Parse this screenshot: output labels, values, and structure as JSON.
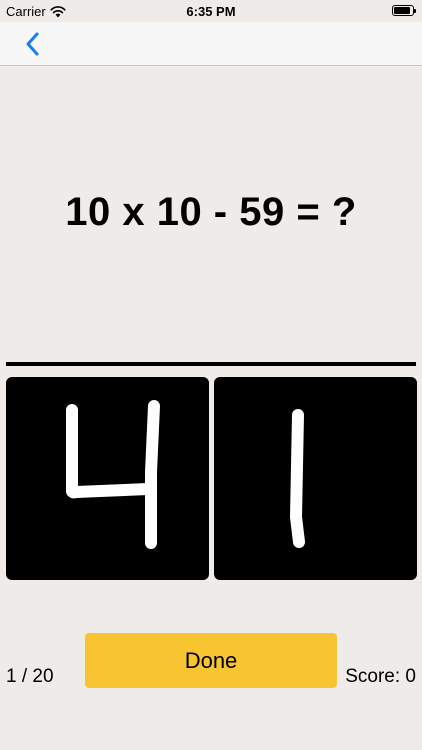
{
  "status_bar": {
    "carrier": "Carrier",
    "time": "6:35 PM",
    "battery_level": 0.9
  },
  "nav": {
    "back_icon": "chevron-left-icon",
    "accent_color": "#1a7cf5"
  },
  "question": {
    "text": "10 x 10 - 59 = ?"
  },
  "answer_pads": [
    {
      "handwritten_digit": "4"
    },
    {
      "handwritten_digit": "1"
    }
  ],
  "footer": {
    "progress": "1 / 20",
    "done_label": "Done",
    "score": "Score: 0",
    "done_color": "#f8c532"
  }
}
